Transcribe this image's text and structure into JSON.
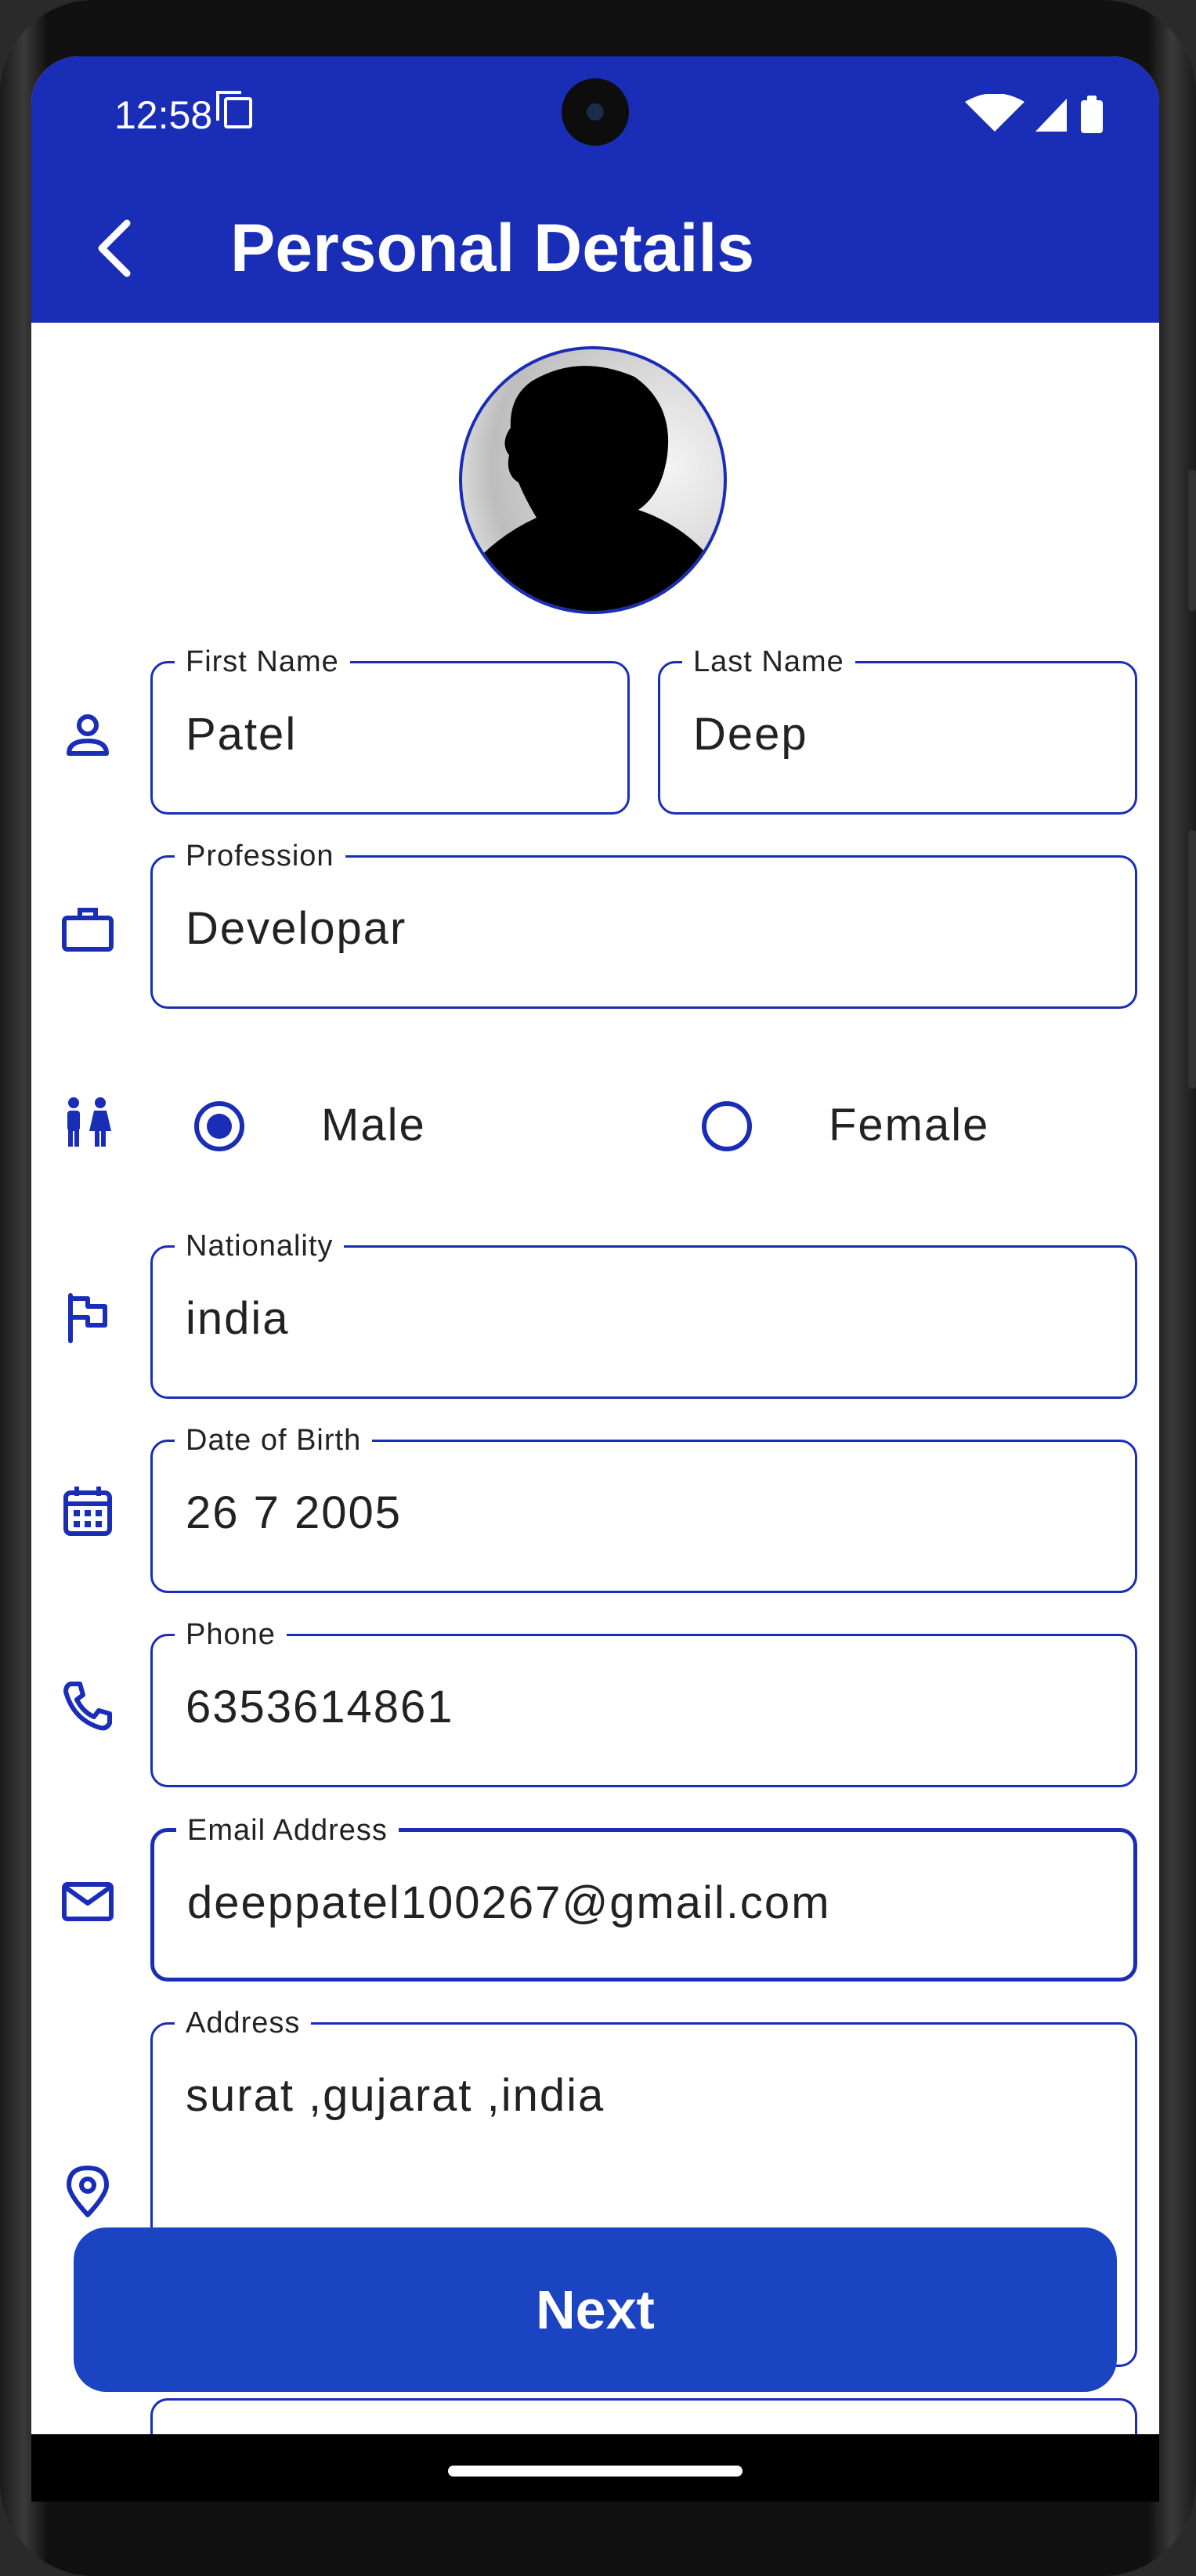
{
  "status_bar": {
    "time": "12:58"
  },
  "app_bar": {
    "title": "Personal Details"
  },
  "form": {
    "first_name": {
      "label": "First Name",
      "value": "Patel"
    },
    "last_name": {
      "label": "Last Name",
      "value": "Deep"
    },
    "profession": {
      "label": "Profession",
      "value": "Developar"
    },
    "gender": {
      "options": [
        "Male",
        "Female"
      ],
      "selected": "Male"
    },
    "nationality": {
      "label": "Nationality",
      "value": "india"
    },
    "dob": {
      "label": "Date of Birth",
      "value": "26 7 2005"
    },
    "phone": {
      "label": "Phone",
      "value": "6353614861"
    },
    "email": {
      "label": "Email Address",
      "value": "deeppatel100267@gmail.com"
    },
    "address": {
      "label": "Address",
      "value": "surat ,gujarat ,india"
    }
  },
  "next_button": {
    "label": "Next"
  },
  "colors": {
    "primary": "#1a2db7",
    "button": "#1a44c2"
  }
}
